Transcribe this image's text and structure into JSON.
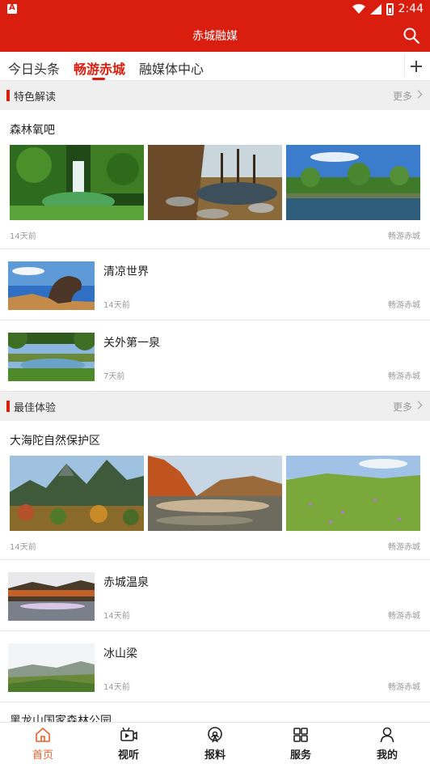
{
  "status_bar": {
    "time": "2:44"
  },
  "app": {
    "title": "赤城融媒"
  },
  "tabs": [
    {
      "label": "今日头条"
    },
    {
      "label": "畅游赤城"
    },
    {
      "label": "融媒体中心"
    }
  ],
  "sections": [
    {
      "name": "特色解读",
      "more": "更多",
      "multi": {
        "title": "森林氧吧",
        "time": "14天前",
        "source": "畅游赤城"
      },
      "items": [
        {
          "title": "清凉世界",
          "time": "14天前",
          "source": "畅游赤城"
        },
        {
          "title": "关外第一泉",
          "time": "7天前",
          "source": "畅游赤城"
        }
      ]
    },
    {
      "name": "最佳体验",
      "more": "更多",
      "multi": {
        "title": "大海陀自然保护区",
        "time": "14天前",
        "source": "畅游赤城"
      },
      "items": [
        {
          "title": "赤城温泉",
          "time": "14天前",
          "source": "畅游赤城"
        },
        {
          "title": "冰山梁",
          "time": "14天前",
          "source": "畅游赤城"
        }
      ]
    }
  ],
  "partial_item": {
    "title": "黑龙山国家森林公园"
  },
  "bottom_nav": [
    {
      "label": "首页",
      "icon": "home-icon"
    },
    {
      "label": "视听",
      "icon": "video-icon"
    },
    {
      "label": "报料",
      "icon": "broadcast-icon"
    },
    {
      "label": "服务",
      "icon": "grid-icon"
    },
    {
      "label": "我的",
      "icon": "user-icon"
    }
  ],
  "colors": {
    "brand": "#d91e0f",
    "nav_active": "#e6622e"
  }
}
